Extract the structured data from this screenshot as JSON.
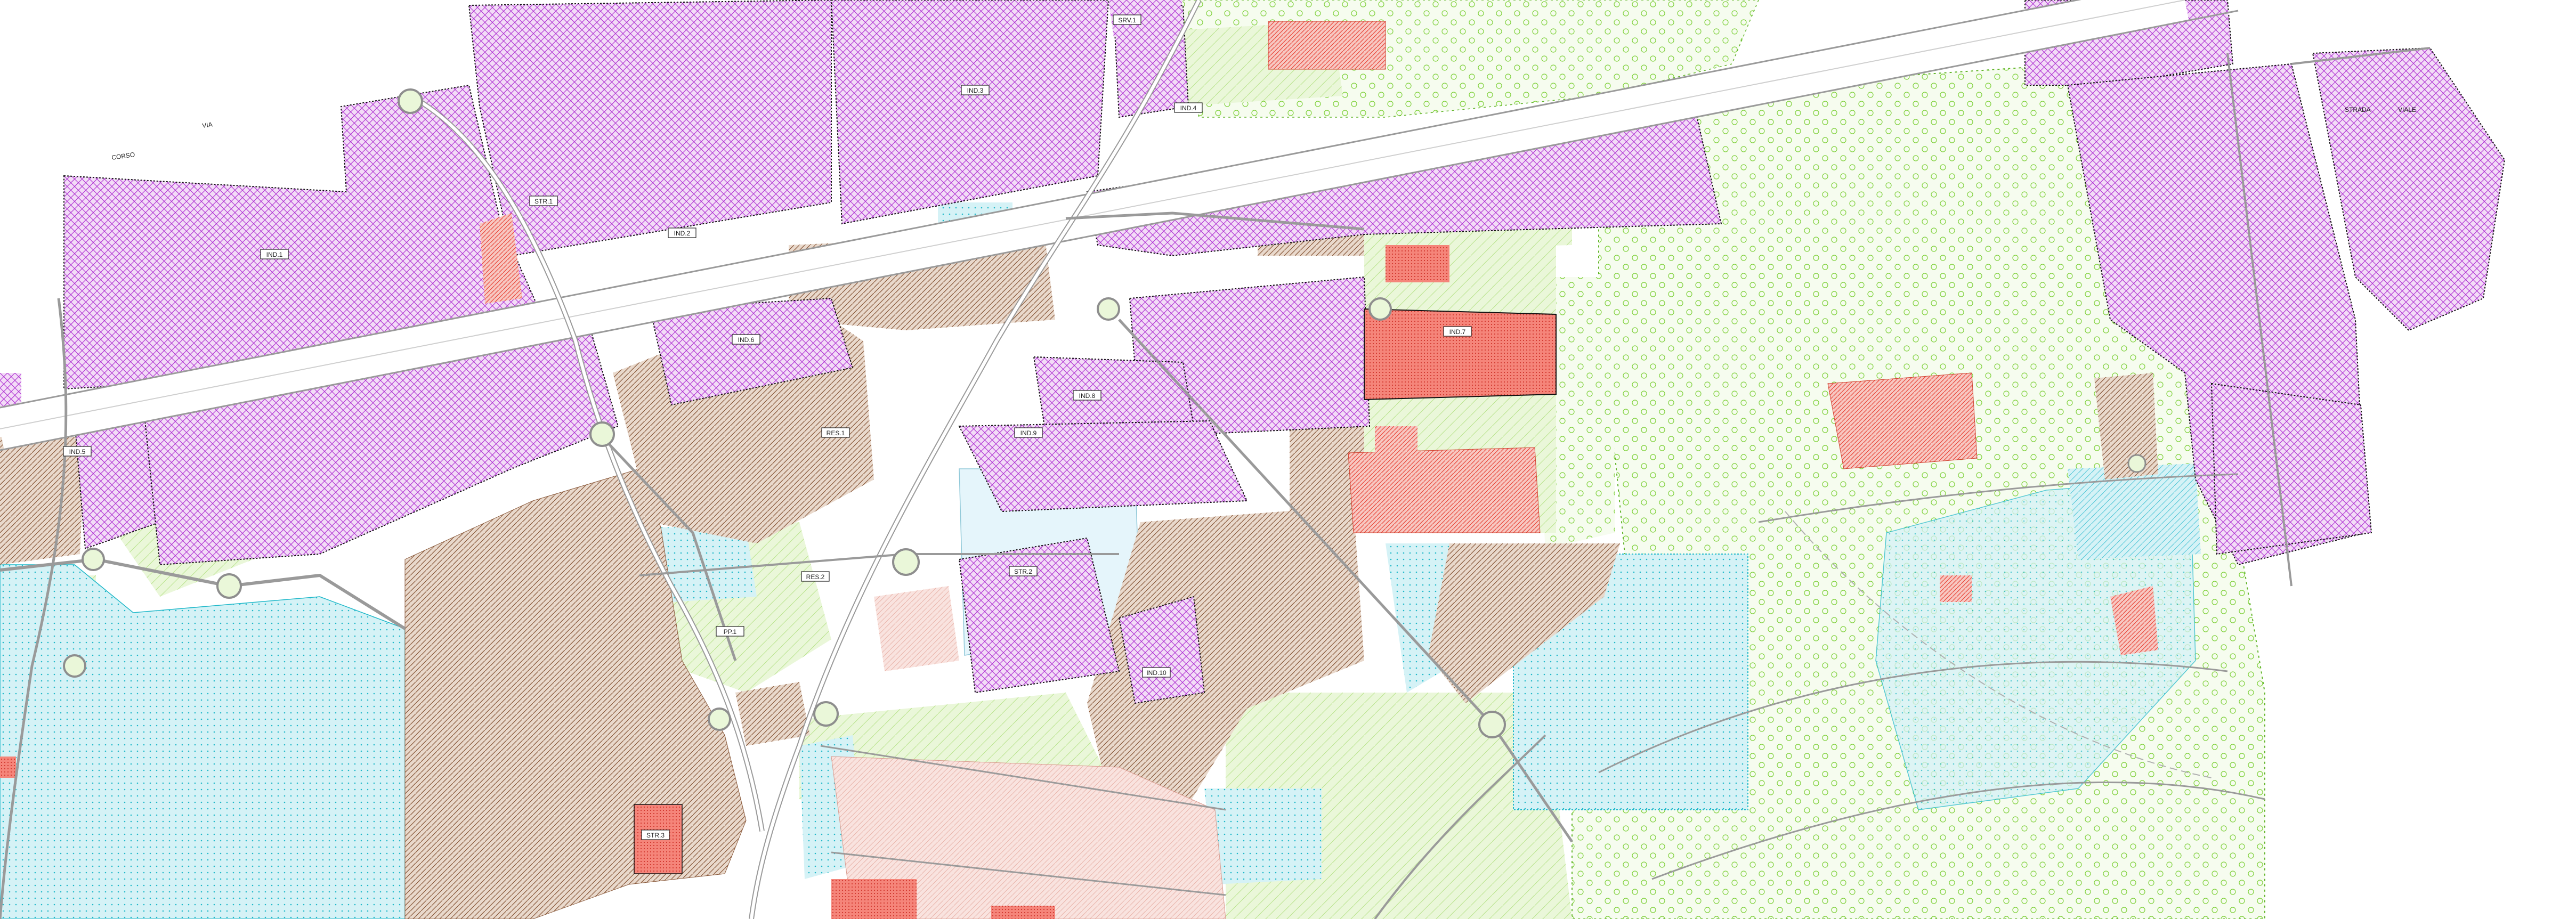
{
  "map": {
    "title": "",
    "colors": {
      "industrial": "#b23ad4",
      "residential": "#8a5a3c",
      "services": "#1fb8c9",
      "green": "#7fd13b",
      "historic": "#e8473a",
      "highway": "#8e8e8e"
    },
    "zone_labels": {
      "z1": "IND.1",
      "z2": "IND.2",
      "z3": "IND.3",
      "z4": "IND.4",
      "z5": "IND.5",
      "z6": "IND.6",
      "z7": "IND.7",
      "z8": "IND.8",
      "z9": "IND.9",
      "z10": "IND.10",
      "z11": "RES.1",
      "z12": "RES.2",
      "z13": "PP.1",
      "z14": "SRV.1",
      "z15": "STR.1",
      "z16": "STR.2",
      "z17": "STR.3"
    },
    "place_labels": {
      "p1": "CORSO",
      "p2": "VIA",
      "p3": "STRADA",
      "p4": "VIALE"
    }
  }
}
